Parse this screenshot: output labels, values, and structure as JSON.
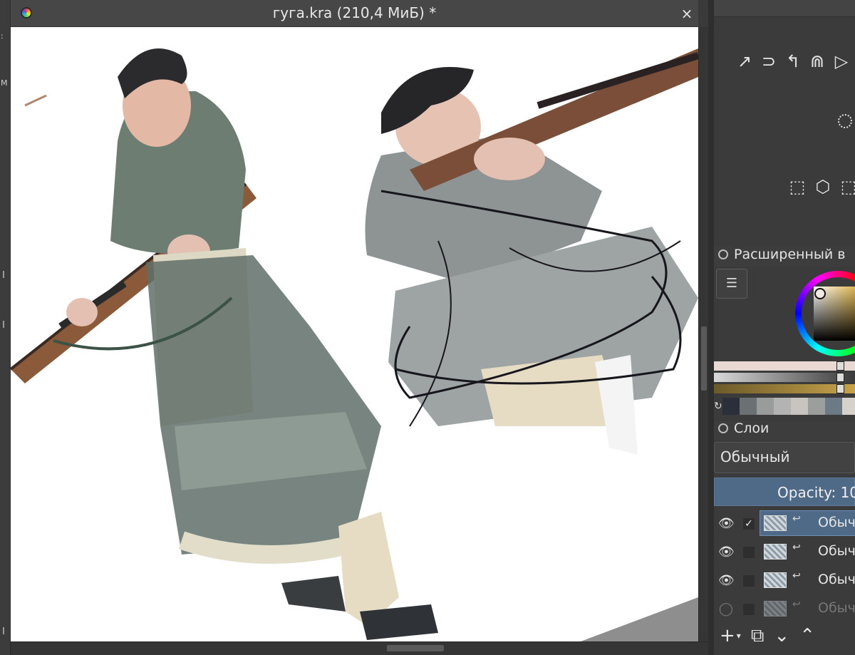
{
  "document": {
    "title": "гуга.kra (210,4 МиБ) *",
    "close_glyph": "×"
  },
  "left_strip": {
    "glyph_colon": ":",
    "glyph_m": "M"
  },
  "dock": {
    "tool_icons": [
      "↗",
      "⊃",
      "↰",
      "⋒",
      "▷"
    ],
    "selection_icons": [
      "⬚",
      "⬡",
      "⬚"
    ],
    "color_panel": {
      "title": "Расширенный в",
      "menu_icon": "☰"
    },
    "palette_swatches": [
      "#2b2f3a",
      "#6b7073",
      "#9a9c9c",
      "#b3b3b3",
      "#c8c5c0",
      "#9c9e9e",
      "#6c7a86",
      "#d6d2cb"
    ],
    "sliders": [
      {
        "gradient": "linear-gradient(to right,#e8d9d3,#e8d9d3)"
      },
      {
        "gradient": "linear-gradient(to right,#d9d9d9,#3a3a3a)"
      },
      {
        "gradient": "linear-gradient(to right,#6b5a2a,#c7a24a)"
      }
    ],
    "layers_panel": {
      "title": "Слои",
      "blend_mode": "Обычный",
      "opacity_label": "Opacity:  10"
    },
    "layers": [
      {
        "name": "Обыч",
        "visible": true,
        "checked": true,
        "active": true
      },
      {
        "name": "Обыч",
        "visible": true,
        "checked": false,
        "active": false
      },
      {
        "name": "Обыч",
        "visible": true,
        "checked": false,
        "active": false
      },
      {
        "name": "Обыч",
        "visible": false,
        "checked": false,
        "active": false
      }
    ],
    "layer_toolbar": {
      "add": "+",
      "add_arrow": "▾",
      "duplicate": "⧉",
      "move_down": "⌄",
      "move_up": "⌃"
    }
  }
}
